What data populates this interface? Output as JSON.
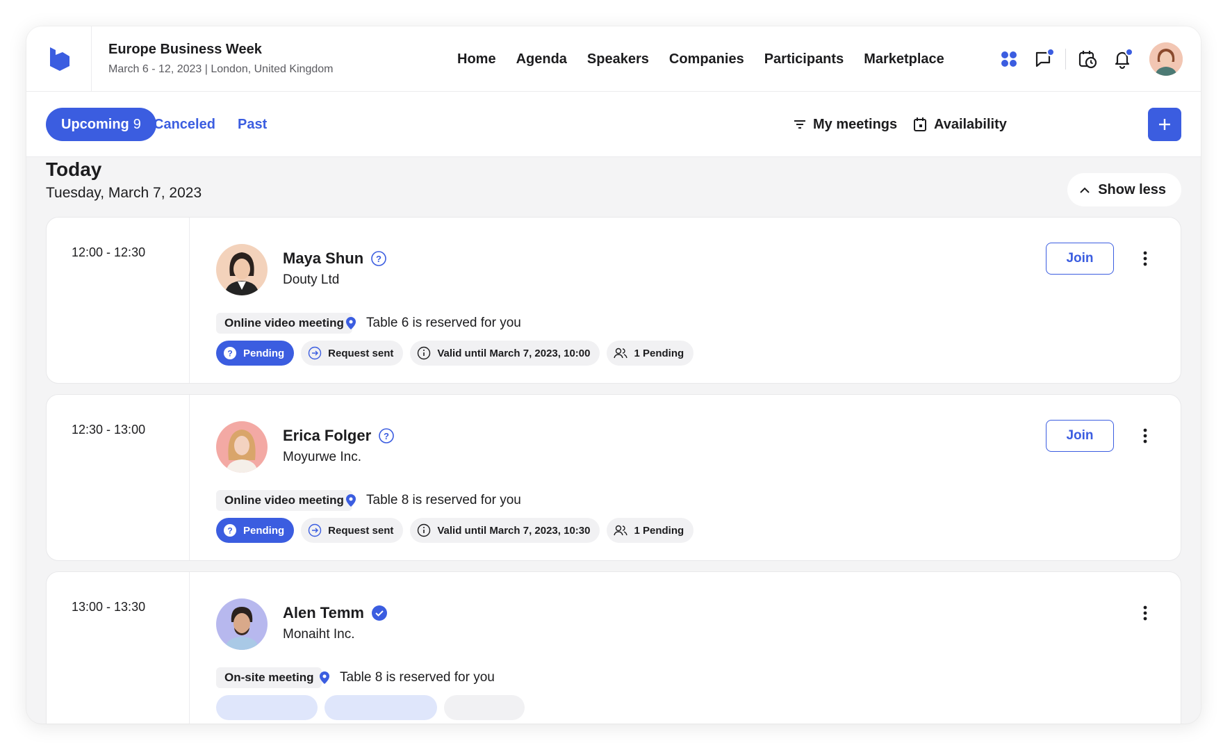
{
  "event": {
    "title": "Europe Business Week",
    "subtitle": "March 6 - 12, 2023 | London, United Kingdom"
  },
  "nav": {
    "items": [
      "Home",
      "Agenda",
      "Speakers",
      "Companies",
      "Participants",
      "Marketplace"
    ]
  },
  "header_icons": [
    "apps-icon",
    "chat-icon",
    "calendar-clock-icon",
    "bell-icon"
  ],
  "tabs": {
    "upcoming_label": "Upcoming",
    "upcoming_count": "9",
    "canceled_label": "Canceled",
    "past_label": "Past"
  },
  "toolbar": {
    "my_meetings": "My meetings",
    "availability": "Availability"
  },
  "today": {
    "title": "Today",
    "date": "Tuesday, March 7, 2023",
    "show_less": "Show less"
  },
  "meetings": [
    {
      "time": "12:00 - 12:30",
      "name": "Maya Shun",
      "company": "Douty Ltd",
      "status_icon": "question-circle-icon",
      "type": "Online video meeting",
      "table": "Table 6 is reserved for you",
      "join_label": "Join",
      "chips": [
        "Pending",
        "Request sent",
        "Valid until March 7, 2023, 10:00",
        "1 Pending"
      ]
    },
    {
      "time": "12:30 - 13:00",
      "name": "Erica Folger",
      "company": "Moyurwe Inc.",
      "status_icon": "question-circle-icon",
      "type": "Online video meeting",
      "table": "Table 8 is reserved for you",
      "join_label": "Join",
      "chips": [
        "Pending",
        "Request sent",
        "Valid until March 7, 2023, 10:30",
        "1 Pending"
      ]
    },
    {
      "time": "13:00 - 13:30",
      "name": "Alen Temm",
      "company": "Monaiht Inc.",
      "status_icon": "verified-check-icon",
      "type": "On-site meeting",
      "table": "Table 8 is reserved for you"
    }
  ],
  "colors": {
    "accent": "#3b5de0",
    "background": "#f4f4f5",
    "chip": "#f1f1f3"
  }
}
